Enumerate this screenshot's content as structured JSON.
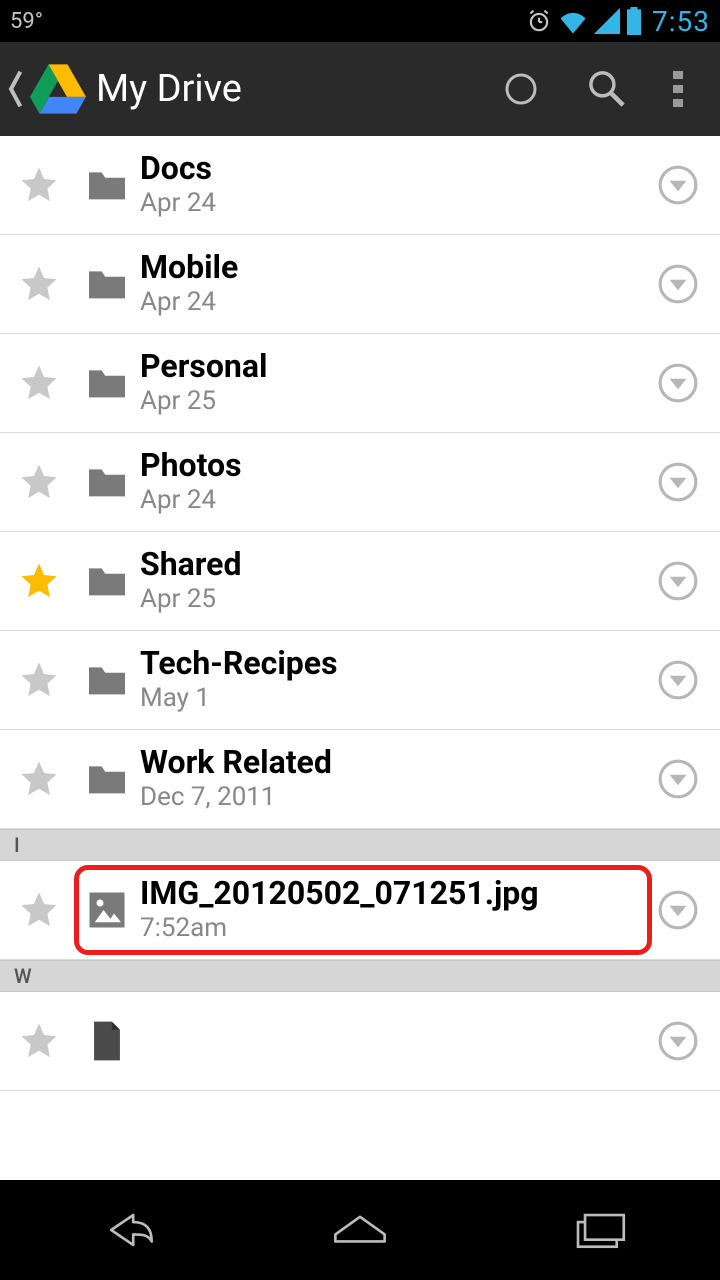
{
  "status": {
    "temperature": "59°",
    "time": "7:53"
  },
  "header": {
    "title": "My Drive"
  },
  "items": [
    {
      "name": "Docs",
      "date": "Apr 24",
      "type": "folder",
      "starred": false
    },
    {
      "name": "Mobile",
      "date": "Apr 24",
      "type": "folder",
      "starred": false
    },
    {
      "name": "Personal",
      "date": "Apr 25",
      "type": "folder",
      "starred": false
    },
    {
      "name": "Photos",
      "date": "Apr 24",
      "type": "folder",
      "starred": false
    },
    {
      "name": "Shared",
      "date": "Apr 25",
      "type": "folder",
      "starred": true
    },
    {
      "name": "Tech-Recipes",
      "date": "May 1",
      "type": "folder",
      "starred": false
    },
    {
      "name": "Work Related",
      "date": "Dec 7, 2011",
      "type": "folder",
      "starred": false
    }
  ],
  "sections": [
    {
      "label": "I",
      "items": [
        {
          "name": "IMG_20120502_071251.jpg",
          "date": "7:52am",
          "type": "image",
          "starred": false,
          "highlighted": true
        }
      ]
    },
    {
      "label": "W",
      "items": [
        {
          "name": "",
          "date": "",
          "type": "doc",
          "starred": false
        }
      ]
    }
  ],
  "colors": {
    "star_on": "#fdbc02",
    "star_off": "#c8c8c8",
    "folder": "#7a7a7a",
    "accent": "#33B5E5"
  }
}
